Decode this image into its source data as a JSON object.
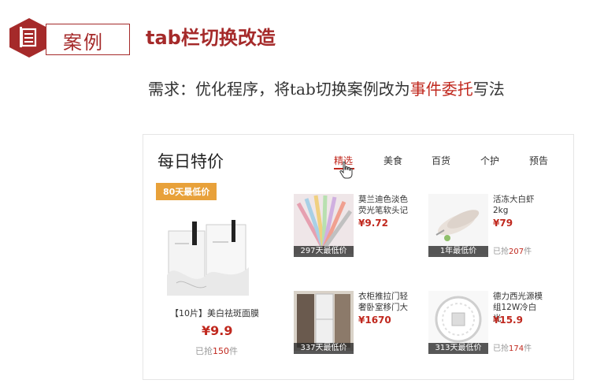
{
  "header": {
    "badge_label": "案例",
    "title": "tab栏切换改造"
  },
  "requirement": {
    "prefix": "需求：优化程序，将tab切换案例改为",
    "highlight": "事件委托",
    "suffix": "写法"
  },
  "card": {
    "title": "每日特价",
    "tabs": [
      {
        "label": "精选",
        "active": true
      },
      {
        "label": "美食",
        "active": false
      },
      {
        "label": "百货",
        "active": false
      },
      {
        "label": "个护",
        "active": false
      },
      {
        "label": "预告",
        "active": false
      }
    ],
    "featured": {
      "badge": "80天最低价",
      "name": "【10片】美白祛斑面膜",
      "price": "¥9.9",
      "sold_prefix": "已抢",
      "sold_count": "150",
      "sold_suffix": "件"
    },
    "products": [
      {
        "name": "莫兰迪色淡色荧光笔软头记",
        "price": "¥9.72",
        "tag": "297天最低价",
        "sold_prefix": "",
        "sold_count": "",
        "sold_suffix": ""
      },
      {
        "name": "活冻大白虾2kg",
        "price": "¥79",
        "tag": "1年最低价",
        "sold_prefix": "已抢",
        "sold_count": "207",
        "sold_suffix": "件"
      },
      {
        "name": "衣柜推拉门轻奢卧室移门大",
        "price": "¥1670",
        "tag": "337天最低价",
        "sold_prefix": "",
        "sold_count": "",
        "sold_suffix": ""
      },
      {
        "name": "德力西光源模组12W冷白光",
        "price": "¥15.9",
        "tag": "313天最低价",
        "sold_prefix": "已抢",
        "sold_count": "174",
        "sold_suffix": "件"
      }
    ]
  },
  "colors": {
    "brand_red": "#a52a2a",
    "price_red": "#c0281e",
    "badge_orange": "#e8a13a"
  },
  "icons": {
    "badge": "document-icon",
    "cursor": "hand-pointer-icon"
  }
}
